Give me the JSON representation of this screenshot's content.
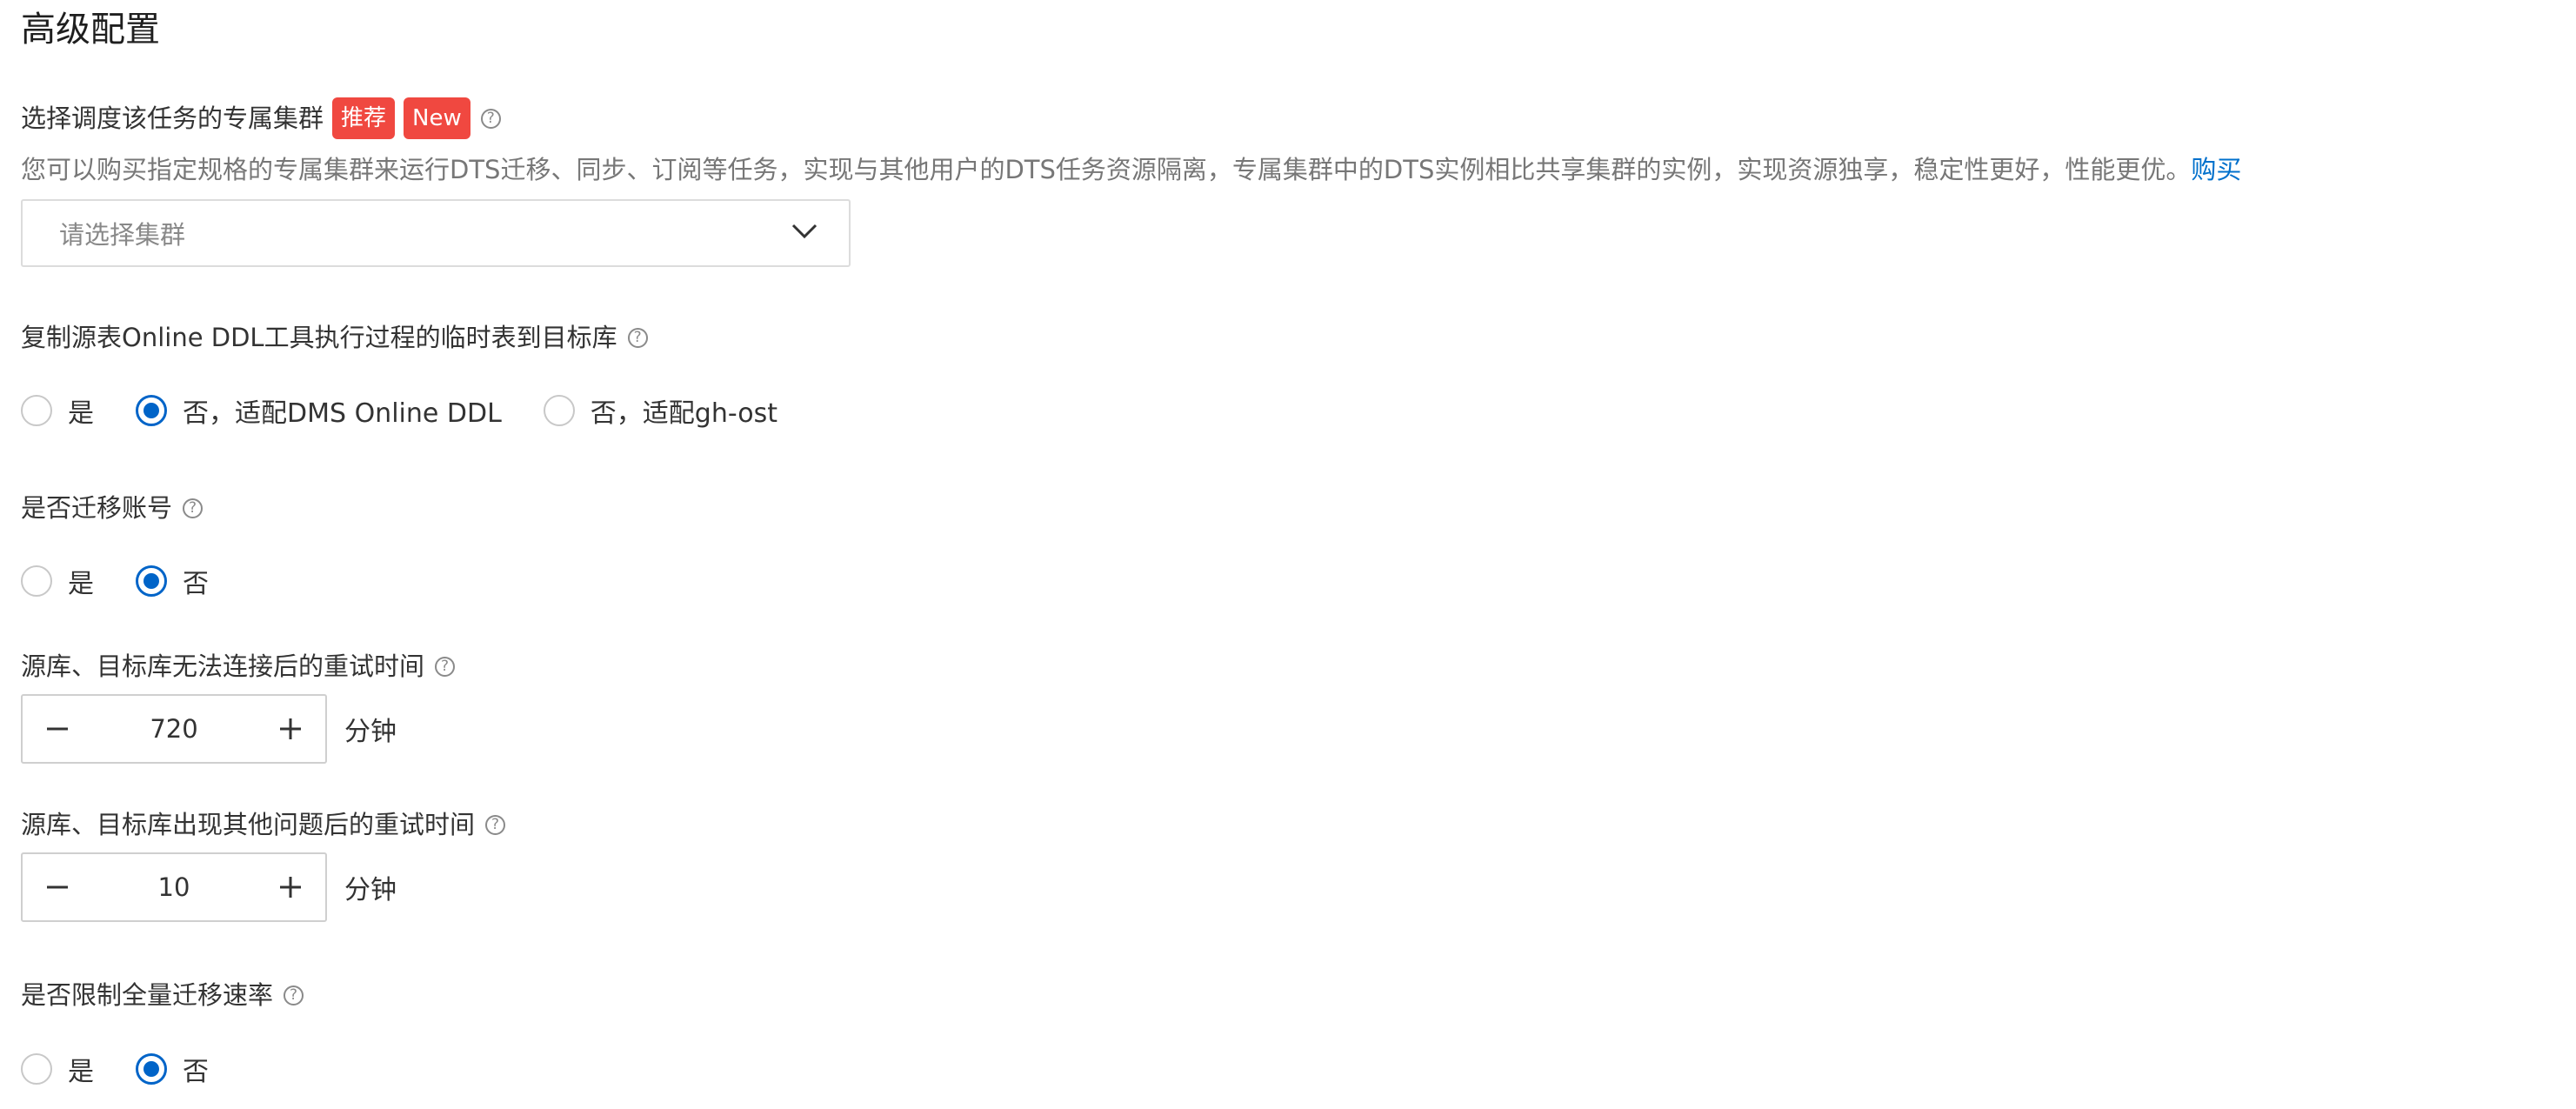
{
  "page": {
    "title": "高级配置"
  },
  "cluster": {
    "label": "选择调度该任务的专属集群",
    "tag_recommend": "推荐",
    "tag_new": "New",
    "description": "您可以购买指定规格的专属集群来运行DTS迁移、同步、订阅等任务，实现与其他用户的DTS任务资源隔离，专属集群中的DTS实例相比共享集群的实例，实现资源独享，稳定性更好，性能更优。",
    "buy_link": "购买",
    "select_placeholder": "请选择集群"
  },
  "online_ddl": {
    "label": "复制源表Online DDL工具执行过程的临时表到目标库",
    "options": [
      {
        "label": "是",
        "checked": false
      },
      {
        "label": "否，适配DMS Online DDL",
        "checked": true
      },
      {
        "label": "否，适配gh-ost",
        "checked": false
      }
    ]
  },
  "migrate_account": {
    "label": "是否迁移账号",
    "options": [
      {
        "label": "是",
        "checked": false
      },
      {
        "label": "否",
        "checked": true
      }
    ]
  },
  "retry_connect": {
    "label": "源库、目标库无法连接后的重试时间",
    "value": "720",
    "unit": "分钟"
  },
  "retry_other": {
    "label": "源库、目标库出现其他问题后的重试时间",
    "value": "10",
    "unit": "分钟"
  },
  "limit_rate": {
    "label": "是否限制全量迁移速率",
    "options": [
      {
        "label": "是",
        "checked": false
      },
      {
        "label": "否",
        "checked": true
      }
    ]
  },
  "icons": {
    "help": "help-icon",
    "chevron": "chevron-down-icon",
    "minus": "minus-icon",
    "plus": "plus-icon"
  },
  "colors": {
    "accent": "#0064c8",
    "tag": "#f04840",
    "link": "#0070cc"
  }
}
